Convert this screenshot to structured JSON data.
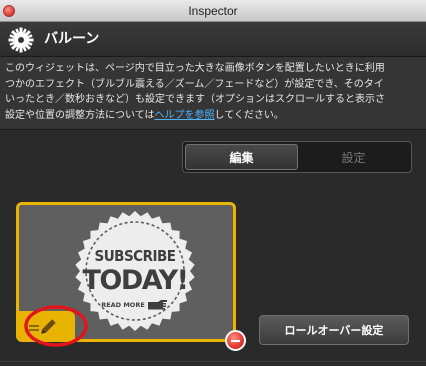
{
  "window": {
    "title": "Inspector"
  },
  "header": {
    "title": "バルーン",
    "icon": "gear-icon"
  },
  "description": {
    "line1": "このウィジェットは、ページ内で目立った大きな画像ボタンを配置したいときに利用",
    "line2": "つかのエフェクト（ブルブル震える／ズーム／フェードなど）が設定でき、そのタイ",
    "line3": "いったとき／数秒おきなど）も設定できます（オプションはスクロールすると表示さ",
    "line4_before": "設定や位置の調整方法については",
    "line4_link": "ヘルプを参照",
    "line4_after": "してください。"
  },
  "segmented": {
    "edit_label": "編集",
    "settings_label": "設定",
    "selected": "編集"
  },
  "preview": {
    "badge_line1": "SUBSCRIBE",
    "badge_line2": "TODAY!",
    "badge_line3": "READ MORE",
    "frame_color": "#e8b400",
    "edit_icon": "pencil-icon",
    "remove_icon": "minus-icon"
  },
  "rollover_button": {
    "label": "ロールオーバー設定"
  }
}
